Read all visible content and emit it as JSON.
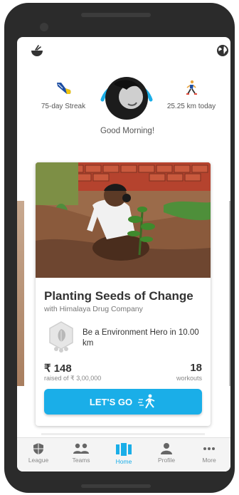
{
  "header": {
    "left_icon": "bowl-icon",
    "right_icon": "globe-icon"
  },
  "stats": {
    "streak_label": "75-day Streak",
    "distance_label": "25.25 km today",
    "greeting": "Good Morning!"
  },
  "cause_card": {
    "title": "Planting Seeds of Change",
    "subtitle": "with Himalaya Drug Company",
    "goal_text": "Be a Environment Hero in 10.00 km",
    "amount": "₹ 148",
    "raised_label": "raised of ₹ 3,00,000",
    "workouts_count": "18",
    "workouts_label": "workouts",
    "button_label": "LET'S GO"
  },
  "nav": {
    "items": [
      {
        "label": "League",
        "icon": "shield-icon"
      },
      {
        "label": "Teams",
        "icon": "team-icon"
      },
      {
        "label": "Home",
        "icon": "home-icon"
      },
      {
        "label": "Profile",
        "icon": "profile-icon"
      },
      {
        "label": "More",
        "icon": "more-icon"
      }
    ],
    "active_index": 2
  },
  "colors": {
    "accent": "#1aaee8",
    "text_dark": "#333333",
    "text_muted": "#888888"
  }
}
